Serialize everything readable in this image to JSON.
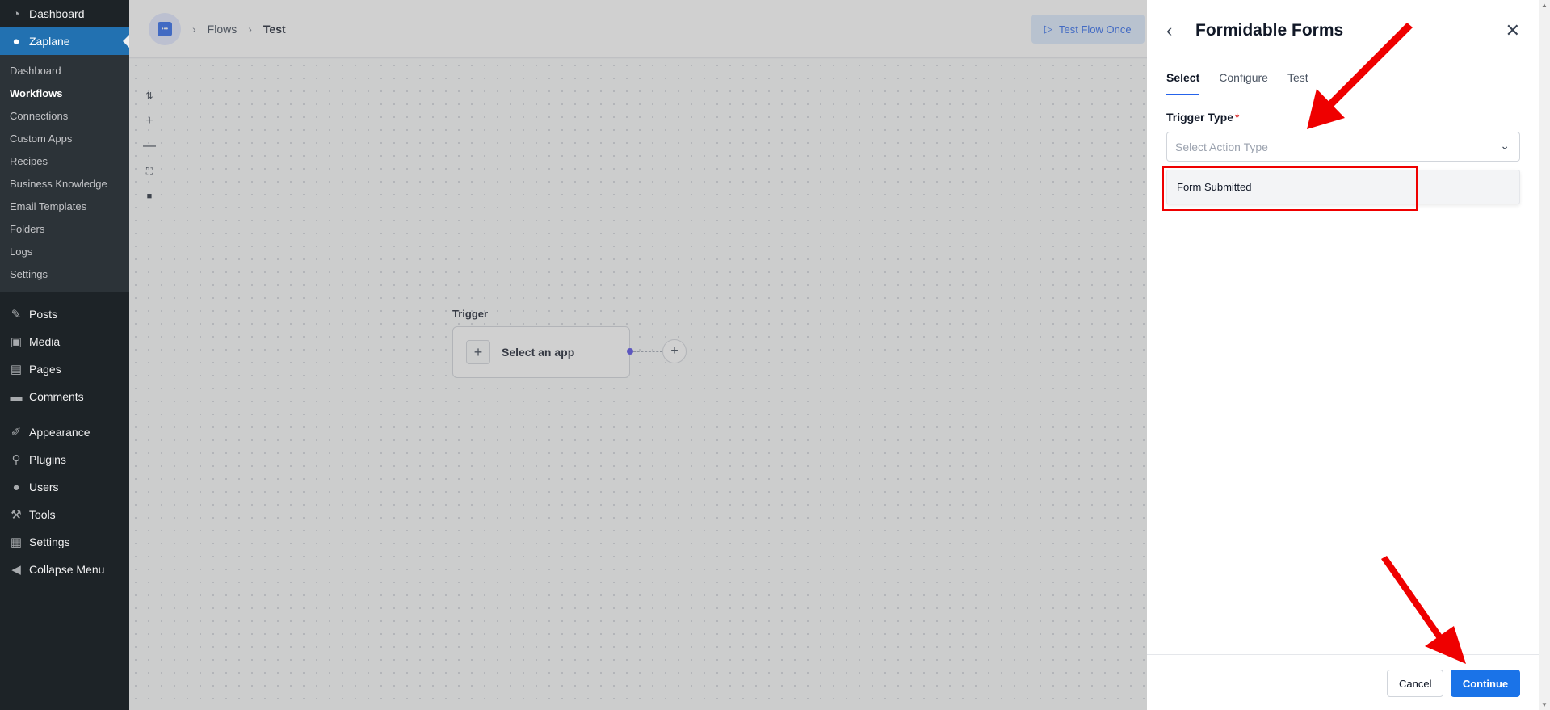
{
  "wp_sidebar": {
    "top_items": [
      {
        "label": "Dashboard",
        "icon": "dashboard-icon"
      },
      {
        "label": "Zaplane",
        "icon": "zaplane-icon"
      }
    ],
    "submenu": [
      "Dashboard",
      "Workflows",
      "Connections",
      "Custom Apps",
      "Recipes",
      "Business Knowledge",
      "Email Templates",
      "Folders",
      "Logs",
      "Settings"
    ],
    "current_submenu": "Workflows",
    "menu_a": [
      {
        "label": "Posts",
        "icon": "pin-icon"
      },
      {
        "label": "Media",
        "icon": "media-icon"
      },
      {
        "label": "Pages",
        "icon": "pages-icon"
      },
      {
        "label": "Comments",
        "icon": "comment-icon"
      }
    ],
    "menu_b": [
      {
        "label": "Appearance",
        "icon": "brush-icon"
      },
      {
        "label": "Plugins",
        "icon": "plug-icon"
      },
      {
        "label": "Users",
        "icon": "user-icon"
      },
      {
        "label": "Tools",
        "icon": "wrench-icon"
      },
      {
        "label": "Settings",
        "icon": "settings-icon"
      },
      {
        "label": "Collapse Menu",
        "icon": "collapse-icon"
      }
    ]
  },
  "header": {
    "breadcrumb": [
      "Flows",
      "Test"
    ],
    "test_button": "Test Flow Once"
  },
  "canvas": {
    "trigger_label": "Trigger",
    "node_label": "Select an app"
  },
  "panel": {
    "title": "Formidable Forms",
    "tabs": [
      "Select",
      "Configure",
      "Test"
    ],
    "active_tab": "Select",
    "field_label": "Trigger Type",
    "required_mark": "*",
    "select_placeholder": "Select Action Type",
    "option": "Form Submitted",
    "cancel": "Cancel",
    "continue": "Continue"
  },
  "colors": {
    "wp_dark": "#1d2327",
    "wp_accent": "#2271b1",
    "primary": "#1a73e8",
    "annotation_red": "#ef0000"
  }
}
